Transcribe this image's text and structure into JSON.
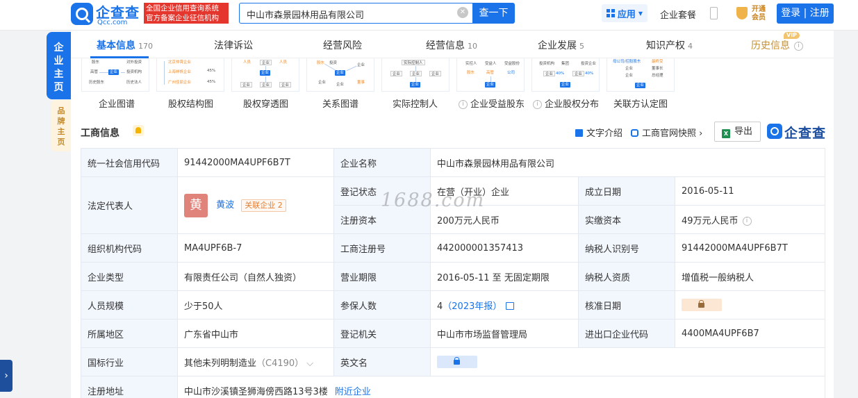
{
  "header": {
    "logo_text": "企查查",
    "logo_sub": "Qcc.com",
    "logo_badge_line1": "全国企业信用查询系统",
    "logo_badge_line2": "官方备案企业征信机构",
    "search_value": "中山市森景园林用品有限公司",
    "search_button": "查一下",
    "app_label": "应用",
    "suite_label": "企业套餐",
    "vip_line1": "开通",
    "vip_line2": "会员",
    "login_label": "登录 | 注册"
  },
  "side": {
    "main_label": [
      "企",
      "业",
      "主",
      "页"
    ],
    "brand_label": [
      "品",
      "牌",
      "主",
      "页"
    ]
  },
  "tabs": [
    {
      "label": "基本信息",
      "count": "170"
    },
    {
      "label": "法律诉讼",
      "count": ""
    },
    {
      "label": "经营风险",
      "count": ""
    },
    {
      "label": "经营信息",
      "count": "10"
    },
    {
      "label": "企业发展",
      "count": "5"
    },
    {
      "label": "知识产权",
      "count": "4"
    },
    {
      "label": "历史信息",
      "count": ""
    }
  ],
  "vip_tag": "VIP",
  "graphs": [
    {
      "label": "企业图谱"
    },
    {
      "label": "股权结构图"
    },
    {
      "label": "股权穿透图"
    },
    {
      "label": "关系图谱"
    },
    {
      "label": "实际控制人"
    },
    {
      "label": "企业受益股东"
    },
    {
      "label": "企业股权分布"
    },
    {
      "label": "关联方认定图"
    }
  ],
  "section": {
    "title": "工商信息",
    "text_intro": "文字介绍",
    "snapshot": "工商官网快照",
    "export": "导出",
    "brand": "企查查"
  },
  "watermark": "1688.com",
  "rows": {
    "credit_code_label": "统一社会信用代码",
    "credit_code": "91442000MA4UPF6B7T",
    "company_name_label": "企业名称",
    "company_name": "中山市森景园林用品有限公司",
    "legal_rep_label": "法定代表人",
    "legal_rep_avatar": "黄",
    "legal_rep_name": "黄波",
    "related_company": "关联企业 2",
    "reg_status_label": "登记状态",
    "reg_status": "在营（开业）企业",
    "found_date_label": "成立日期",
    "found_date": "2016-05-11",
    "reg_capital_label": "注册资本",
    "reg_capital": "200万元人民币",
    "paid_capital_label": "实缴资本",
    "paid_capital": "49万元人民币",
    "org_code_label": "组织机构代码",
    "org_code": "MA4UPF6B-7",
    "biz_reg_no_label": "工商注册号",
    "biz_reg_no": "442000001357413",
    "taxpayer_id_label": "纳税人识别号",
    "taxpayer_id": "91442000MA4UPF6B7T",
    "company_type_label": "企业类型",
    "company_type": "有限责任公司（自然人独资）",
    "biz_period_label": "营业期限",
    "biz_period": "2016-05-11 至 无固定期限",
    "taxpayer_qual_label": "纳税人资质",
    "taxpayer_qual": "增值税一般纳税人",
    "staff_size_label": "人员规模",
    "staff_size": "少于50人",
    "insured_label": "参保人数",
    "insured_count": "4",
    "insured_year": "（2023年报）",
    "approval_date_label": "核准日期",
    "region_label": "所属地区",
    "region": "广东省中山市",
    "reg_authority_label": "登记机关",
    "reg_authority": "中山市市场监督管理局",
    "import_export_label": "进出口企业代码",
    "import_export_code": "4400MA4UPF6B7",
    "industry_label": "国标行业",
    "industry": "其他未列明制造业",
    "industry_code": "（C4190）",
    "english_name_label": "英文名",
    "address_label": "注册地址",
    "address": "中山市沙溪镇圣狮海傍西路13号3楼",
    "nearby": "附近企业"
  }
}
